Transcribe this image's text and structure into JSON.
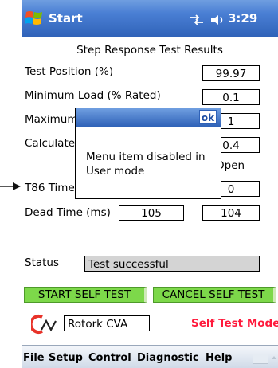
{
  "titlebar": {
    "app": "Start",
    "time": "3:29"
  },
  "form": {
    "title": "Step Response Test Results",
    "test_position_label": "Test Position (%)",
    "test_position_value": "99.97",
    "min_load_label": "Minimum Load (% Rated)",
    "min_load_value": "0.1",
    "max_label": "Maximum",
    "max_value": "1",
    "calc_label": "Calculate",
    "calc_value": "0.4",
    "open_text": "Open",
    "t86_label": "T86 Time",
    "t86_value": "0",
    "dead_time_label": "Dead Time (ms)",
    "dead_time_a": "105",
    "dead_time_b": "104",
    "status_label": "Status",
    "status_value": "Test successful"
  },
  "dialog": {
    "ok_label": "ok",
    "message": "Menu item disabled in User mode"
  },
  "buttons": {
    "start": "START SELF TEST",
    "cancel": "CANCEL SELF TEST"
  },
  "footer": {
    "device_name": "Rotork CVA",
    "mode": "Self Test Mode"
  },
  "menubar": {
    "items": [
      "File",
      "Setup",
      "Control",
      "Diagnostic",
      "Help"
    ]
  },
  "colors": {
    "titlebar": "#2f62b8",
    "button_green": "#7dd84a",
    "mode_red": "#ff1a3c",
    "logo_red": "#e8332a"
  }
}
